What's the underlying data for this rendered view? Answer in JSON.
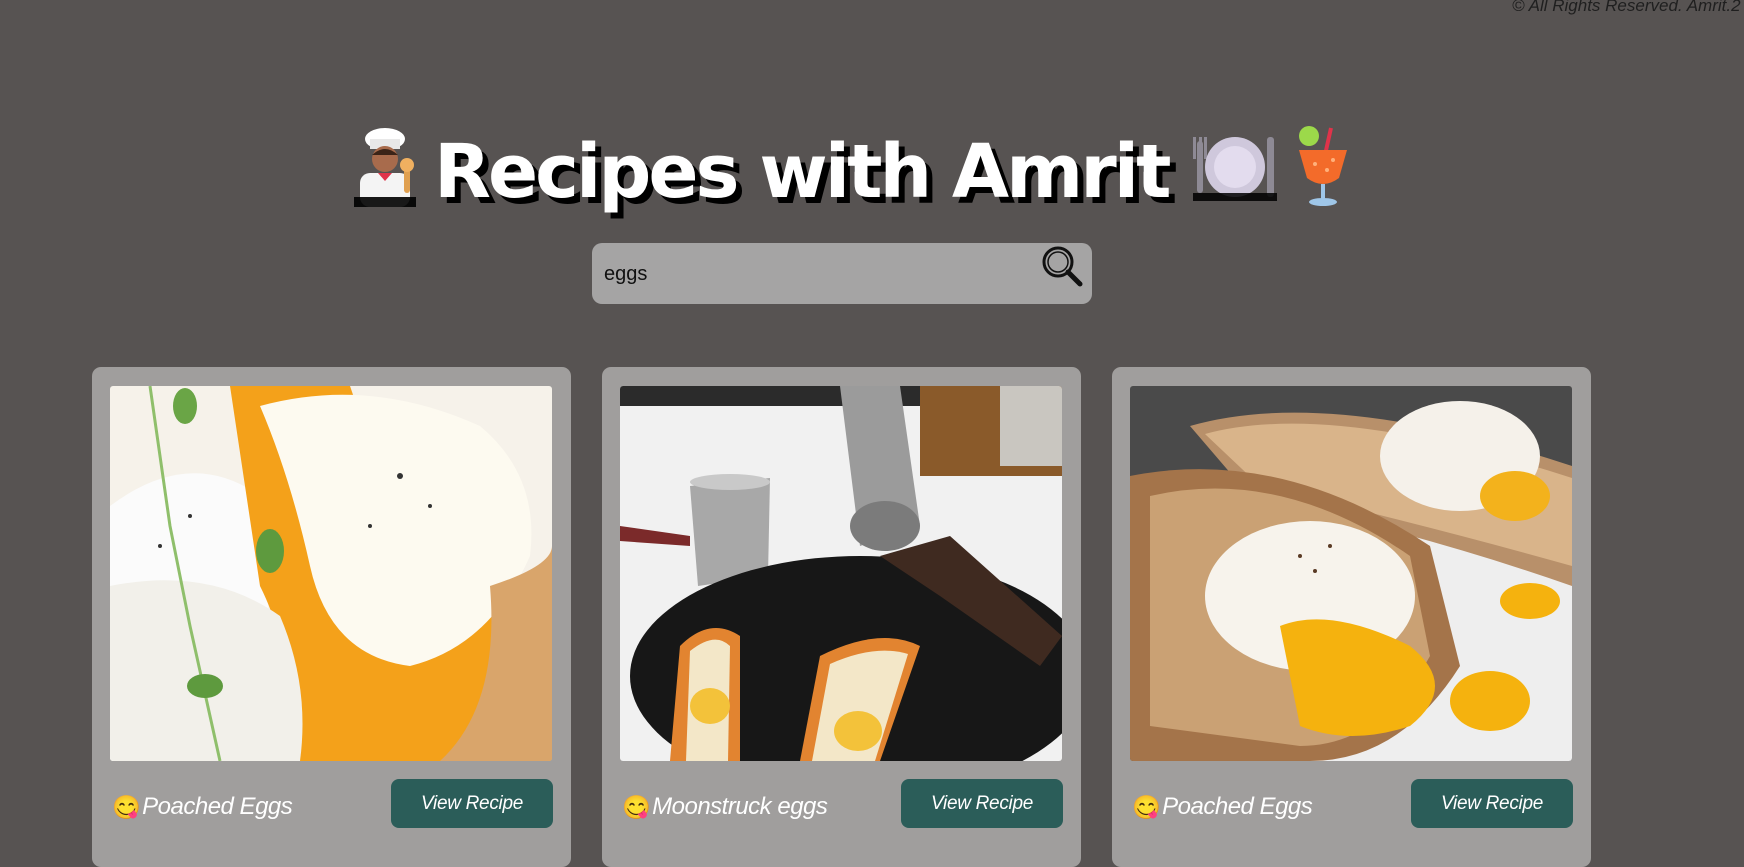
{
  "footer": {
    "copyright": "© All Rights Reserved. Amrit.2"
  },
  "header": {
    "title": "Recipes with Amrit",
    "icons": [
      "chef-icon",
      "plate-icon",
      "cocktail-icon"
    ]
  },
  "search": {
    "value": "eggs",
    "icon": "search-icon"
  },
  "recipes": [
    {
      "title": "Poached Eggs",
      "button_label": "View Recipe",
      "emoji": "😋"
    },
    {
      "title": "Moonstruck eggs",
      "button_label": "View Recipe",
      "emoji": "😋"
    },
    {
      "title": "Poached Eggs",
      "button_label": "View Recipe",
      "emoji": "😋"
    }
  ],
  "colors": {
    "background": "#575352",
    "card": "#a09e9d",
    "button": "#2b5d59",
    "search_bar": "#a5a4a4"
  }
}
